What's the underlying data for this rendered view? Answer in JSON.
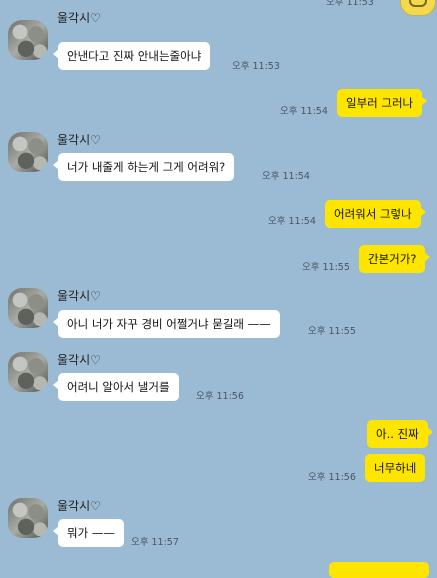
{
  "contact_name": "울각시♡",
  "top_timestamp": "오후 11:53",
  "messages": [
    {
      "side": "in",
      "text": "안낸다고 진짜 안내는줄아냐",
      "time": "오후 11:53"
    },
    {
      "side": "out",
      "text": "일부러 그러나",
      "time": "오후 11:54"
    },
    {
      "side": "in",
      "text": "너가 내줄게  하는게 그게 어려워?",
      "time": "오후 11:54"
    },
    {
      "side": "out",
      "text": "어려워서 그렇나",
      "time": "오후 11:54"
    },
    {
      "side": "out",
      "text": "간본거가?",
      "time": "오후 11:55"
    },
    {
      "side": "in",
      "text": "아니 너가 자꾸 경비 어쩔거냐 묻길래 ——",
      "time": "오후 11:55"
    },
    {
      "side": "in",
      "text": "어려니 알아서 낼거를",
      "time": "오후 11:56"
    },
    {
      "side": "out",
      "text": "아.. 진짜",
      "time": ""
    },
    {
      "side": "out",
      "text": "너무하네",
      "time": "오후 11:56"
    },
    {
      "side": "in",
      "text": "뭐가 ——",
      "time": "오후 11:57"
    }
  ],
  "colors": {
    "background": "#9bbbd4",
    "incoming_bubble": "#ffffff",
    "outgoing_bubble": "#fee500"
  }
}
